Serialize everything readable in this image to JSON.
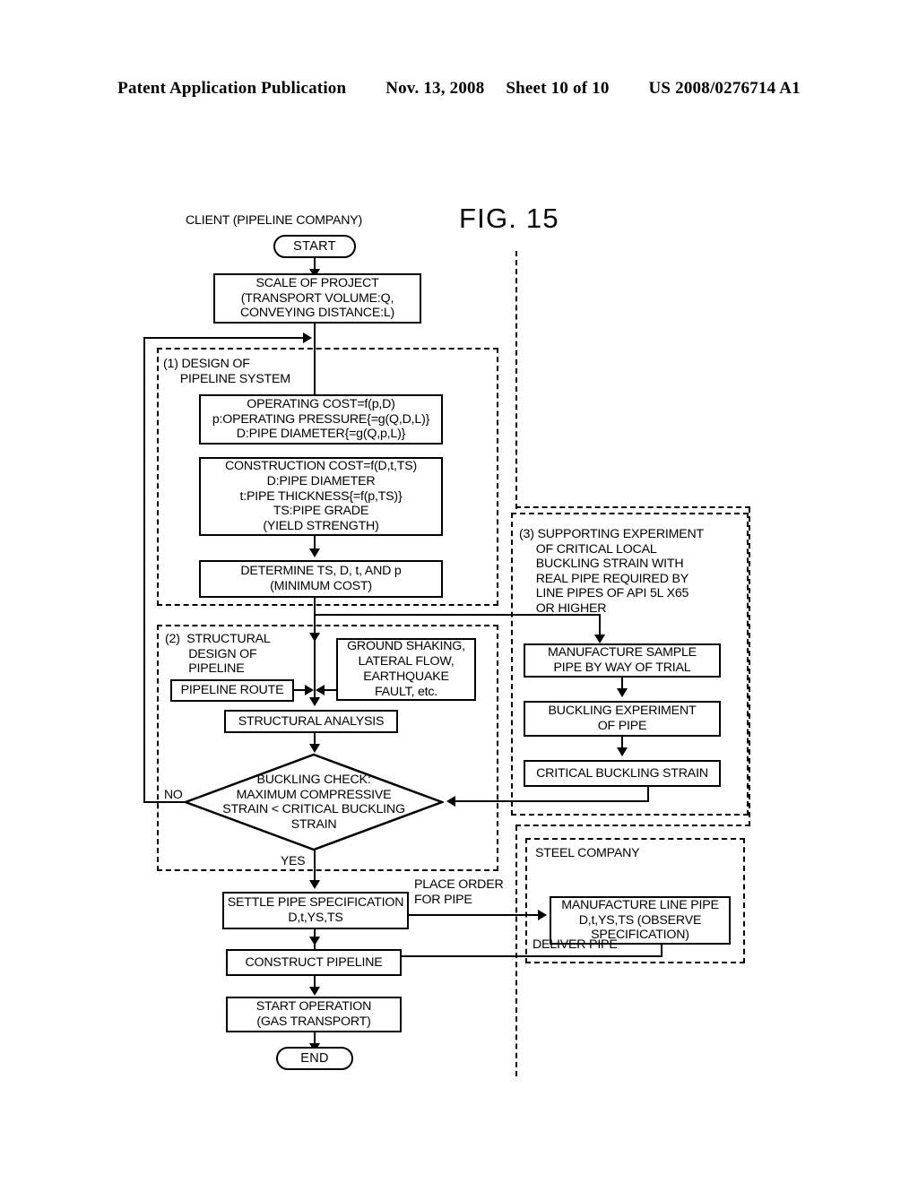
{
  "header": {
    "publication": "Patent Application Publication",
    "date": "Nov. 13, 2008",
    "sheet": "Sheet 10 of 10",
    "number": "US 2008/0276714 A1"
  },
  "figure": {
    "title": "FIG. 15"
  },
  "labels": {
    "client": "CLIENT (PIPELINE COMPANY)",
    "group1": "(1) DESIGN OF\n     PIPELINE SYSTEM",
    "group2": "(2)  STRUCTURAL\n       DESIGN OF\n       PIPELINE",
    "group3": "(3) SUPPORTING EXPERIMENT\n     OF CRITICAL LOCAL\n     BUCKLING STRAIN WITH\n     REAL PIPE REQUIRED BY\n     LINE PIPES OF API 5L X65\n     OR HIGHER",
    "steel_company": "STEEL COMPANY",
    "place_order": "PLACE ORDER\nFOR PIPE",
    "deliver_pipe": "DELIVER PIPE",
    "no": "NO",
    "yes": "YES"
  },
  "nodes": {
    "start": "START",
    "scale_of_project": "SCALE OF PROJECT\n(TRANSPORT VOLUME:Q,\nCONVEYING DISTANCE:L)",
    "operating_cost": "OPERATING COST=f(p,D)\np:OPERATING PRESSURE{=g(Q,D,L)}\nD:PIPE DIAMETER{=g(Q,p,L)}",
    "construction_cost": "CONSTRUCTION COST=f(D,t,TS)\n D:PIPE DIAMETER\n  t:PIPE THICKNESS{=f(p,TS)}\nTS:PIPE GRADE\n    (YIELD STRENGTH)",
    "determine": "DETERMINE TS, D, t, AND p\n(MINIMUM COST)",
    "pipeline_route": "PIPELINE ROUTE",
    "hazards": "GROUND SHAKING,\nLATERAL FLOW,\nEARTHQUAKE\nFAULT, etc.",
    "structural_analysis": "STRUCTURAL ANALYSIS",
    "buckling_check": "BUCKLING CHECK:\nMAXIMUM COMPRESSIVE\nSTRAIN < CRITICAL BUCKLING\nSTRAIN",
    "manufacture_sample": "MANUFACTURE SAMPLE\nPIPE BY WAY OF TRIAL",
    "buckling_experiment": "BUCKLING EXPERIMENT\nOF PIPE",
    "critical_buckling_strain": "CRITICAL BUCKLING STRAIN",
    "settle_spec": "SETTLE PIPE SPECIFICATION\nD,t,YS,TS",
    "manufacture_line_pipe": "MANUFACTURE LINE PIPE\nD,t,YS,TS (OBSERVE\nSPECIFICATION)",
    "construct_pipeline": "CONSTRUCT PIPELINE",
    "start_operation": "START OPERATION\n(GAS TRANSPORT)",
    "end": "END"
  }
}
